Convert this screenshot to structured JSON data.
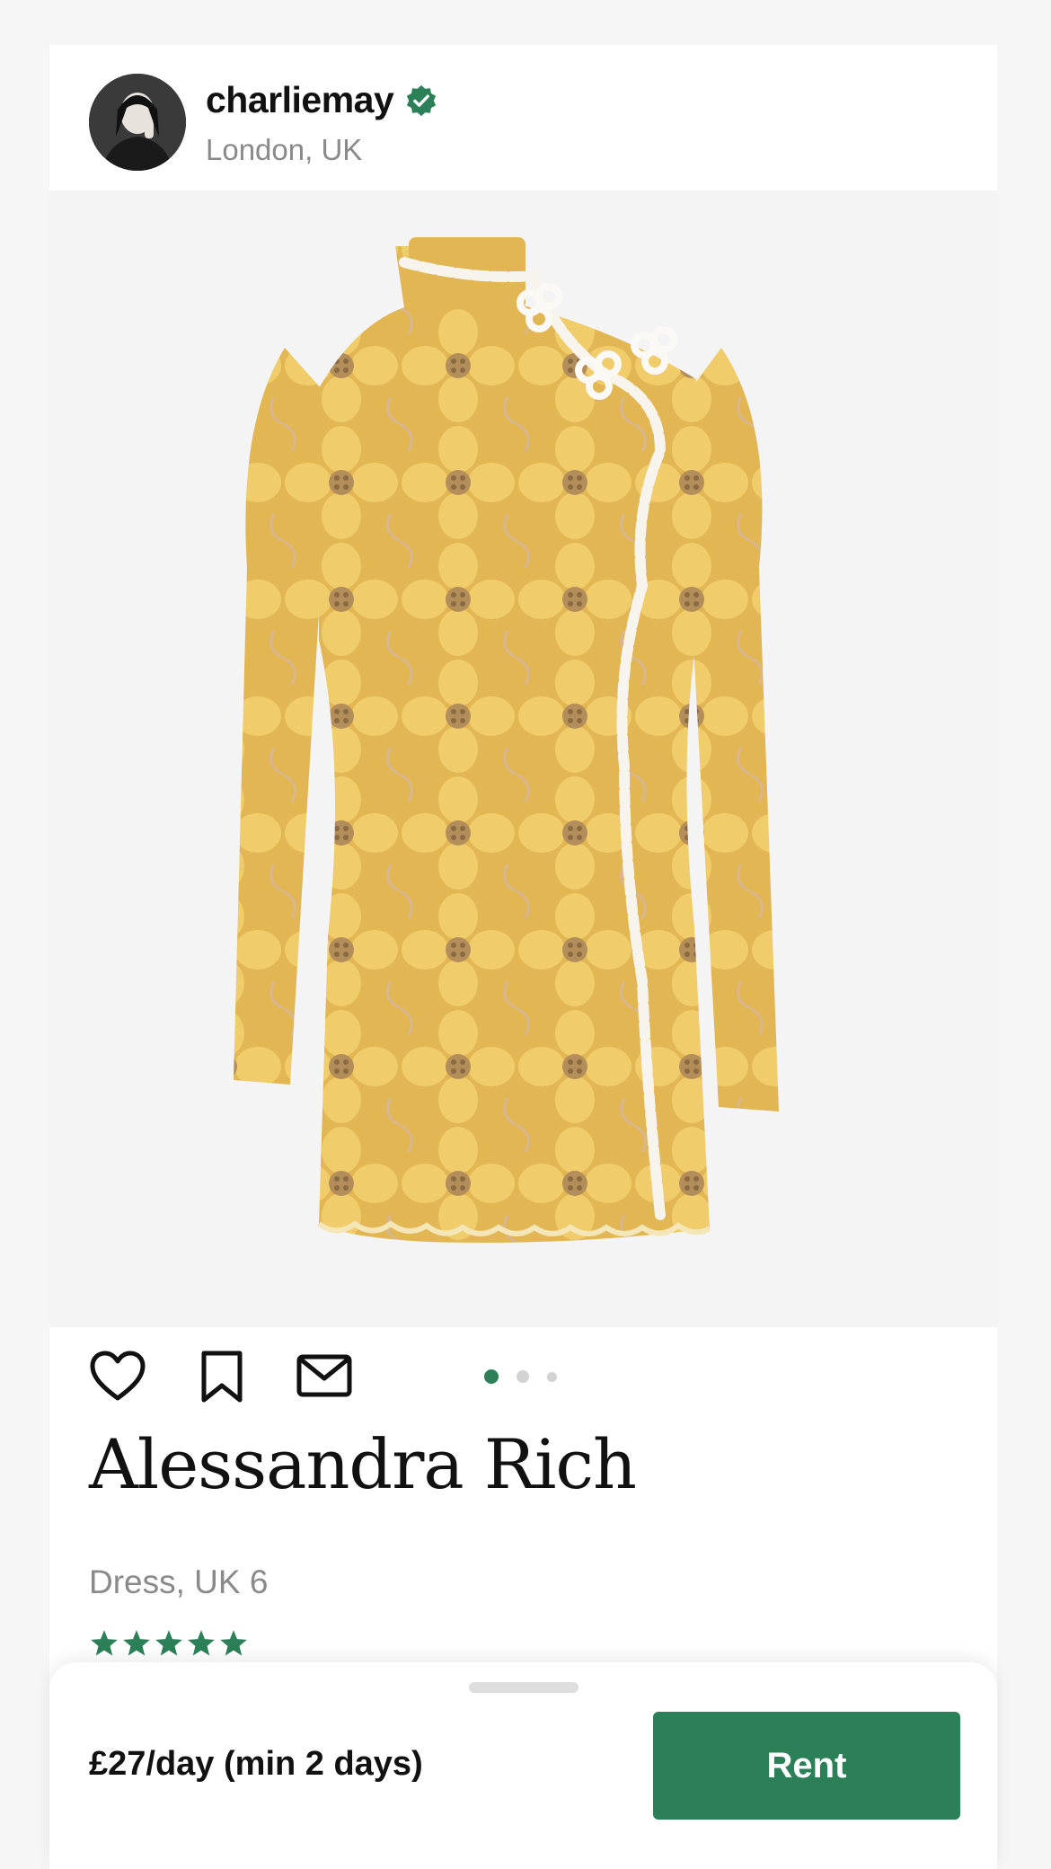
{
  "profile": {
    "username": "charliemay",
    "location": "London, UK",
    "verified": true,
    "avatar_icon": "avatar-photo"
  },
  "product": {
    "image_icon": "yellow-lace-dress-image",
    "brand": "Alessandra Rich",
    "description": "Dress, UK 6",
    "rating": 5,
    "rating_max": 5,
    "carousel": {
      "total": 3,
      "active": 1
    }
  },
  "actions": {
    "like_icon": "heart-icon",
    "save_icon": "bookmark-icon",
    "message_icon": "mail-icon"
  },
  "sheet": {
    "price": "£27/day (min 2 days)",
    "rent_label": "Rent"
  },
  "colors": {
    "accent": "#2b8058",
    "text": "#111111",
    "muted": "#8a8a8a",
    "dress": "#e6bc55"
  }
}
